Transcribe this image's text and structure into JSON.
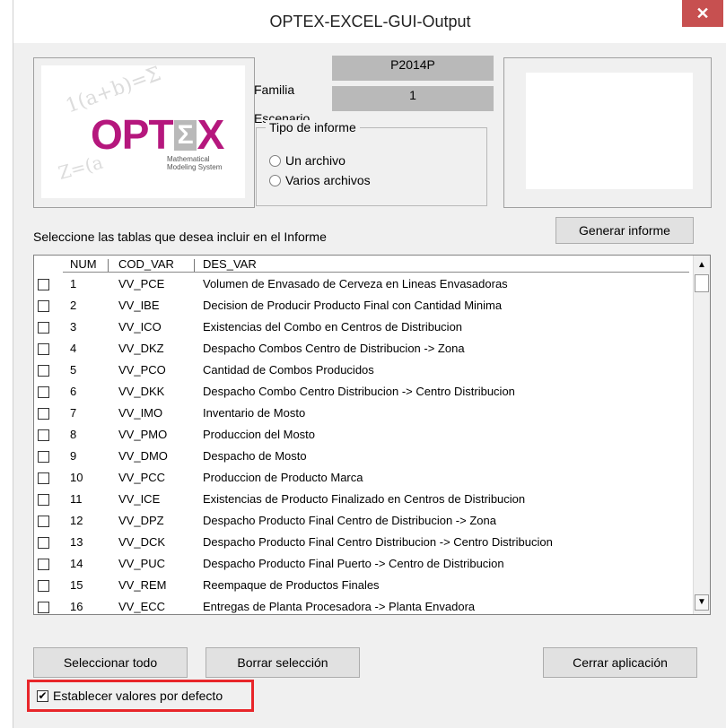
{
  "window": {
    "title": "OPTEX-EXCEL-GUI-Output",
    "close_glyph": "✕"
  },
  "logo": {
    "text": "OPT",
    "sigma": "Σ",
    "x": "X",
    "tag1": "Mathematical",
    "tag2": "Modeling System"
  },
  "familia": {
    "label": "Familia",
    "value": "P2014P"
  },
  "escenario": {
    "label": "Escenario",
    "value": "1"
  },
  "tipo": {
    "legend": "Tipo de informe",
    "options": [
      "Un archivo",
      "Varios archivos"
    ]
  },
  "instruction": "Seleccione las tablas que desea incluir en el Informe",
  "generar_label": "Generar informe",
  "list": {
    "headers": [
      "NUM",
      "COD_VAR",
      "DES_VAR"
    ],
    "rows": [
      {
        "num": "1",
        "cod": "VV_PCE",
        "des": "Volumen de Envasado de Cerveza en Lineas Envasadoras"
      },
      {
        "num": "2",
        "cod": "VV_IBE",
        "des": "Decision de Producir Producto Final con Cantidad Minima"
      },
      {
        "num": "3",
        "cod": "VV_ICO",
        "des": "Existencias del Combo en Centros de Distribucion"
      },
      {
        "num": "4",
        "cod": "VV_DKZ",
        "des": "Despacho Combos Centro de Distribucion -> Zona"
      },
      {
        "num": "5",
        "cod": "VV_PCO",
        "des": "Cantidad de Combos Producidos"
      },
      {
        "num": "6",
        "cod": "VV_DKK",
        "des": "Despacho Combo Centro Distribucion -> Centro Distribucion"
      },
      {
        "num": "7",
        "cod": "VV_IMO",
        "des": "Inventario de Mosto"
      },
      {
        "num": "8",
        "cod": "VV_PMO",
        "des": "Produccion del Mosto"
      },
      {
        "num": "9",
        "cod": "VV_DMO",
        "des": "Despacho de Mosto"
      },
      {
        "num": "10",
        "cod": "VV_PCC",
        "des": "Produccion de Producto Marca"
      },
      {
        "num": "11",
        "cod": "VV_ICE",
        "des": "Existencias de Producto Finalizado en Centros de Distribucion"
      },
      {
        "num": "12",
        "cod": "VV_DPZ",
        "des": "Despacho Producto Final Centro de Distribucion -> Zona"
      },
      {
        "num": "13",
        "cod": "VV_DCK",
        "des": "Despacho Producto Final Centro Distribucion -> Centro Distribucion"
      },
      {
        "num": "14",
        "cod": "VV_PUC",
        "des": "Despacho Producto Final Puerto -> Centro de Distribucion"
      },
      {
        "num": "15",
        "cod": "VV_REM",
        "des": "Reempaque de Productos Finales"
      },
      {
        "num": "16",
        "cod": "VV_ECC",
        "des": "Entregas de Planta Procesadora -> Planta Envadora"
      }
    ]
  },
  "buttons": {
    "select_all": "Seleccionar todo",
    "clear": "Borrar selección",
    "close_app": "Cerrar aplicación"
  },
  "defaults": {
    "label": "Establecer valores por defecto",
    "checked_glyph": "✔"
  },
  "colors": {
    "highlight_border": "#e8262a",
    "close_button": "#c75050",
    "logo_magenta": "#b5177d"
  }
}
